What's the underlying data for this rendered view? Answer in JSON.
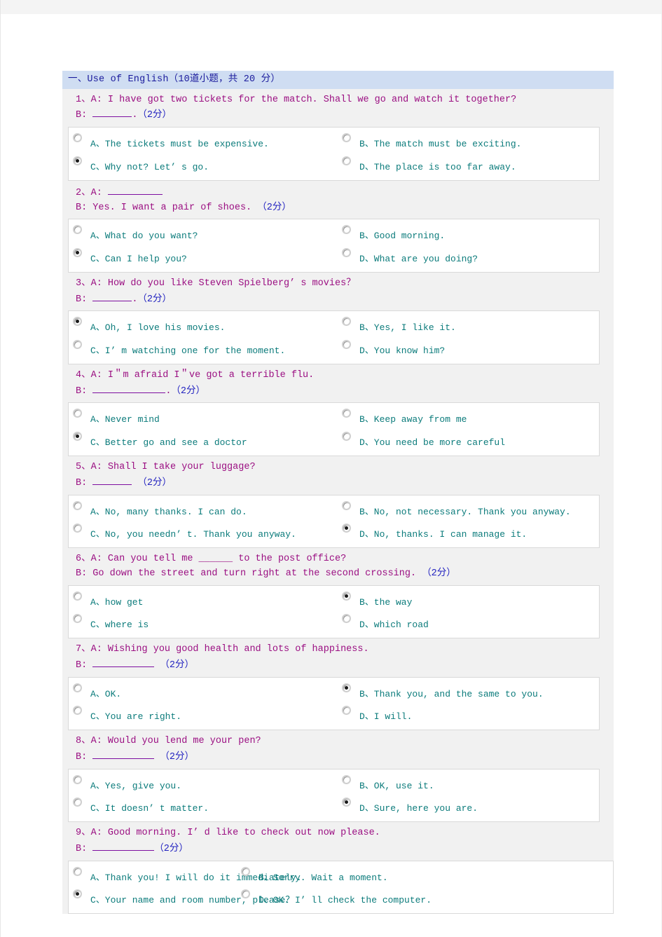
{
  "section": {
    "title": "一、Use of English（10道小题，共 20 分）"
  },
  "score_label": "（2分）",
  "questions": [
    {
      "number": "1、",
      "line_a": "A: I have got two tickets for the match. Shall we go and watch it together?",
      "line_b_prefix": "B: ",
      "blank_width": 56,
      "line_b_suffix": ".",
      "score": "（2分）",
      "layout": "standard",
      "options": [
        {
          "key": "A",
          "label": "A、The  tickets  must  be  expensive.",
          "checked": false
        },
        {
          "key": "B",
          "label": "B、The  match  must  be  exciting.",
          "checked": false
        },
        {
          "key": "C",
          "label": "C、Why  not?  Let’ s  go.",
          "checked": true
        },
        {
          "key": "D",
          "label": "D、The  place  is  too  far  away.",
          "checked": false
        }
      ]
    },
    {
      "number": "2、",
      "line_a": "A: ",
      "line_a_blank": 78,
      "line_b_prefix": "B: Yes. I want a pair of shoes. ",
      "blank_width": 0,
      "line_b_suffix": "",
      "score": "（2分）",
      "layout": "standard",
      "options": [
        {
          "key": "A",
          "label": "A、What  do  you  want?",
          "checked": false
        },
        {
          "key": "B",
          "label": "B、Good  morning.",
          "checked": false
        },
        {
          "key": "C",
          "label": "C、Can  I  help  you?",
          "checked": true
        },
        {
          "key": "D",
          "label": "D、What  are  you  doing?",
          "checked": false
        }
      ]
    },
    {
      "number": "3、",
      "line_a": "A: How do you like Steven Spielberg’ s movies？",
      "line_b_prefix": "B: ",
      "blank_width": 56,
      "line_b_suffix": ".",
      "score": "（2分）",
      "layout": "standard",
      "options": [
        {
          "key": "A",
          "label": "A、Oh,  I  love  his  movies.",
          "checked": true
        },
        {
          "key": "B",
          "label": "B、Yes,  I  like  it.",
          "checked": false
        },
        {
          "key": "C",
          "label": "C、I’ m  watching  one  for  the  moment.",
          "checked": false
        },
        {
          "key": "D",
          "label": "D、You  know  him?",
          "checked": false
        }
      ]
    },
    {
      "number": "4、",
      "line_a": "A: I＂m afraid I＂ve got a terrible flu.",
      "line_b_prefix": "B: ",
      "blank_width": 104,
      "line_b_suffix": ".",
      "score": "（2分）",
      "layout": "standard",
      "options": [
        {
          "key": "A",
          "label": "A、Never  mind",
          "checked": false
        },
        {
          "key": "B",
          "label": "B、Keep  away  from  me",
          "checked": false
        },
        {
          "key": "C",
          "label": "C、Better  go  and  see  a  doctor",
          "checked": true
        },
        {
          "key": "D",
          "label": "D、You  need  be  more  careful",
          "checked": false
        }
      ]
    },
    {
      "number": "5、",
      "line_a": "A: Shall I take your luggage?",
      "line_b_prefix": "B: ",
      "blank_width": 56,
      "line_b_suffix": " ",
      "score": "（2分）",
      "layout": "standard",
      "options": [
        {
          "key": "A",
          "label": "A、No,  many  thanks.  I  can  do.",
          "checked": false
        },
        {
          "key": "B",
          "label": "B、No,  not  necessary.  Thank  you  anyway.",
          "checked": false
        },
        {
          "key": "C",
          "label": "C、No,  you  needn’ t.  Thank  you  anyway.",
          "checked": false
        },
        {
          "key": "D",
          "label": "D、No,  thanks.  I  can  manage  it.",
          "checked": true
        }
      ]
    },
    {
      "number": "6、",
      "line_a": "A: Can you tell me ______ to the post office?",
      "line_b_prefix": "B: Go down the street and turn right at the second crossing. ",
      "blank_width": 0,
      "line_b_suffix": "",
      "score": "（2分）",
      "layout": "standard",
      "options": [
        {
          "key": "A",
          "label": "A、how  get",
          "checked": false
        },
        {
          "key": "B",
          "label": "B、the  way",
          "checked": true
        },
        {
          "key": "C",
          "label": "C、where  is",
          "checked": false
        },
        {
          "key": "D",
          "label": "D、which  road",
          "checked": false
        }
      ]
    },
    {
      "number": "7、",
      "line_a": "A: Wishing you good health and lots of happiness.",
      "line_b_prefix": "B: ",
      "blank_width": 88,
      "line_b_suffix": "  ",
      "score": "（2分）",
      "layout": "standard",
      "options": [
        {
          "key": "A",
          "label": "A、OK.",
          "checked": false
        },
        {
          "key": "B",
          "label": "B、Thank  you,  and  the  same  to  you.",
          "checked": true
        },
        {
          "key": "C",
          "label": "C、You  are  right.",
          "checked": false
        },
        {
          "key": "D",
          "label": "D、I  will.",
          "checked": false
        }
      ]
    },
    {
      "number": "8、",
      "line_a": "A: Would you lend me your pen?",
      "line_b_prefix": "B: ",
      "blank_width": 88,
      "line_b_suffix": "  ",
      "score": "（2分）",
      "layout": "standard",
      "options": [
        {
          "key": "A",
          "label": "A、Yes,  give  you.",
          "checked": false
        },
        {
          "key": "B",
          "label": "B、OK,  use  it.",
          "checked": false
        },
        {
          "key": "C",
          "label": "C、It  doesn’ t  matter.",
          "checked": false
        },
        {
          "key": "D",
          "label": "D、Sure,  here  you  are.",
          "checked": true
        }
      ]
    },
    {
      "number": "9、",
      "line_a": "A: Good morning. I’ d like to check out now please.",
      "line_b_prefix": "B: ",
      "blank_width": 88,
      "line_b_suffix": "",
      "score": "（2分）",
      "layout": "narrow",
      "options": [
        {
          "key": "A",
          "label": "A、Thank  you!  I  will  do  it  immediately.",
          "checked": false
        },
        {
          "key": "B",
          "label": "B、Sorry.  Wait  a  moment.",
          "checked": false
        },
        {
          "key": "C",
          "label": "C、Your  name  and  room  number,  please？",
          "checked": true
        },
        {
          "key": "D",
          "label": "D、OK.  I’ ll  check  the  computer.",
          "checked": false
        }
      ]
    }
  ]
}
